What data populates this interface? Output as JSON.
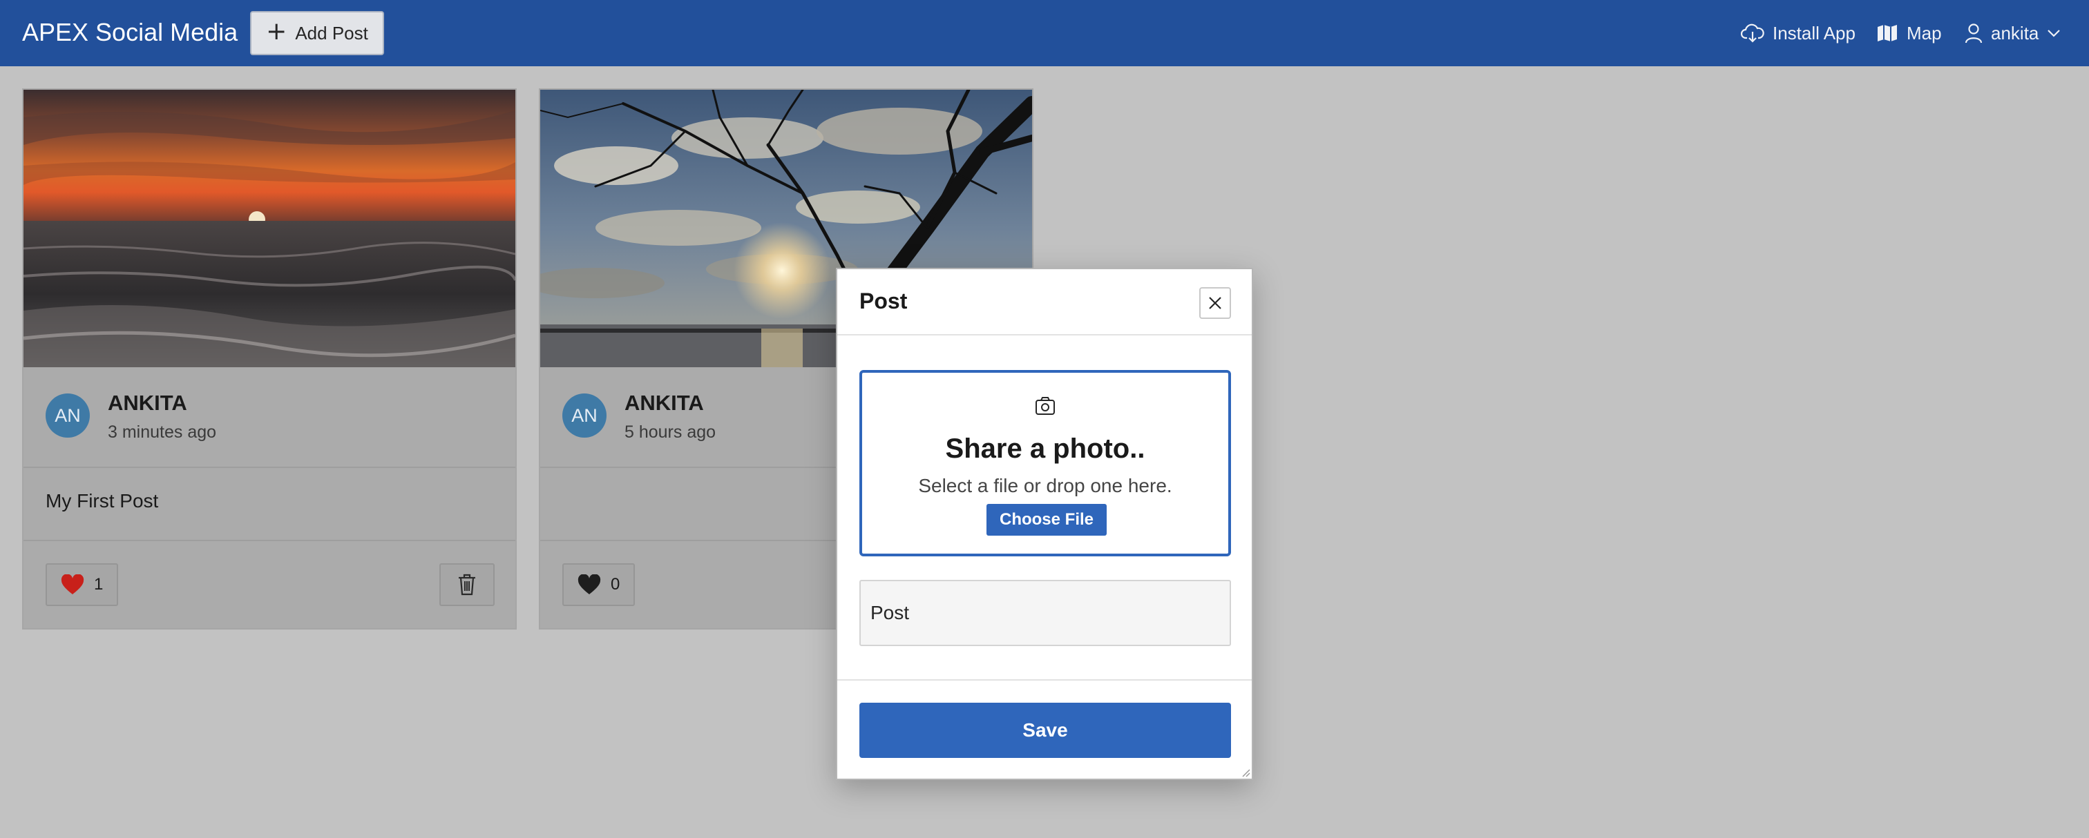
{
  "header": {
    "app_title": "APEX Social Media",
    "add_post_label": "Add Post",
    "nav": {
      "install_app": "Install App",
      "map": "Map",
      "user": "ankita"
    }
  },
  "colors": {
    "header_bg": "#22509b",
    "overlay_bg": "#c2c2c2",
    "accent": "#2f66bb",
    "like_active": "#c8201a",
    "avatar": "#3f7aa6"
  },
  "posts": [
    {
      "image": "sunset-over-sea-photo",
      "avatar_initials": "AN",
      "author": "ANKITA",
      "time": "3 minutes ago",
      "text": "My First Post",
      "likes": "1",
      "liked": true,
      "has_delete": true
    },
    {
      "image": "tree-branch-silhouette-beach-photo",
      "avatar_initials": "AN",
      "author": "ANKITA",
      "time": "5 hours ago",
      "text": "",
      "likes": "0",
      "liked": false,
      "has_delete": false
    }
  ],
  "dialog": {
    "title": "Post",
    "dropzone": {
      "title": "Share a photo..",
      "subtitle": "Select a file or drop one here.",
      "button": "Choose File"
    },
    "post_placeholder": "Post",
    "save_label": "Save"
  }
}
